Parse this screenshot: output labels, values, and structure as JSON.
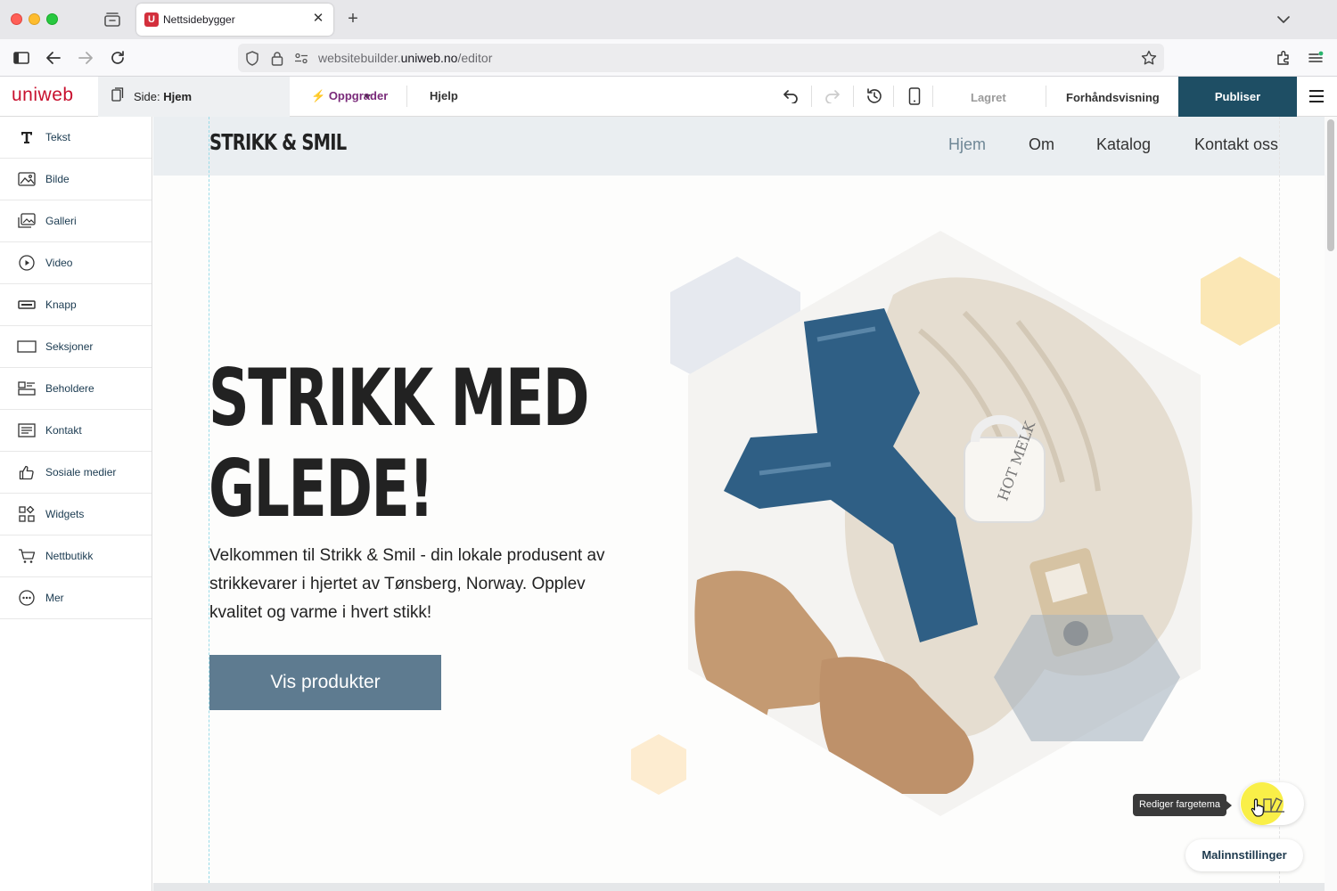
{
  "browser": {
    "tab_title": "Nettsidebygger",
    "tab_favicon": "U",
    "url_prefix": "websitebuilder.",
    "url_domain": "uniweb.no",
    "url_path": "/editor"
  },
  "editor": {
    "logo": "uniweb",
    "page_prefix": "Side: ",
    "page_name": "Hjem",
    "upgrade": "Oppgrader",
    "help": "Hjelp",
    "saved": "Lagret",
    "preview": "Forhåndsvisning",
    "publish": "Publiser"
  },
  "sidebar": {
    "items": [
      {
        "label": "Tekst",
        "icon": "text-icon"
      },
      {
        "label": "Bilde",
        "icon": "image-icon"
      },
      {
        "label": "Galleri",
        "icon": "gallery-icon"
      },
      {
        "label": "Video",
        "icon": "video-icon"
      },
      {
        "label": "Knapp",
        "icon": "button-icon"
      },
      {
        "label": "Seksjoner",
        "icon": "sections-icon"
      },
      {
        "label": "Beholdere",
        "icon": "containers-icon"
      },
      {
        "label": "Kontakt",
        "icon": "contact-icon"
      },
      {
        "label": "Sosiale medier",
        "icon": "thumbs-up-icon"
      },
      {
        "label": "Widgets",
        "icon": "widgets-icon"
      },
      {
        "label": "Nettbutikk",
        "icon": "cart-icon"
      },
      {
        "label": "Mer",
        "icon": "more-icon"
      }
    ]
  },
  "site": {
    "logo": "STRIKK & SMIL",
    "nav": [
      "Hjem",
      "Om",
      "Katalog",
      "Kontakt oss"
    ],
    "hero_line1": "STRIKK MED",
    "hero_line2": "GLEDE!",
    "hero_text": "Velkommen til Strikk & Smil - din lokale produsent av strikkevarer i hjertet av Tønsberg, Norway. Opplev kvalitet og varme i hvert stikk!",
    "cta": "Vis produkter",
    "mug_text": "HOT MELK"
  },
  "overlay": {
    "tooltip": "Rediger fargetema",
    "template_settings": "Malinnstillinger"
  },
  "colors": {
    "publish": "#1e4e64",
    "brand_red": "#c8102e",
    "cta": "#5e7b90",
    "site_header": "#eaeef1",
    "active_nav": "#6f8796"
  }
}
